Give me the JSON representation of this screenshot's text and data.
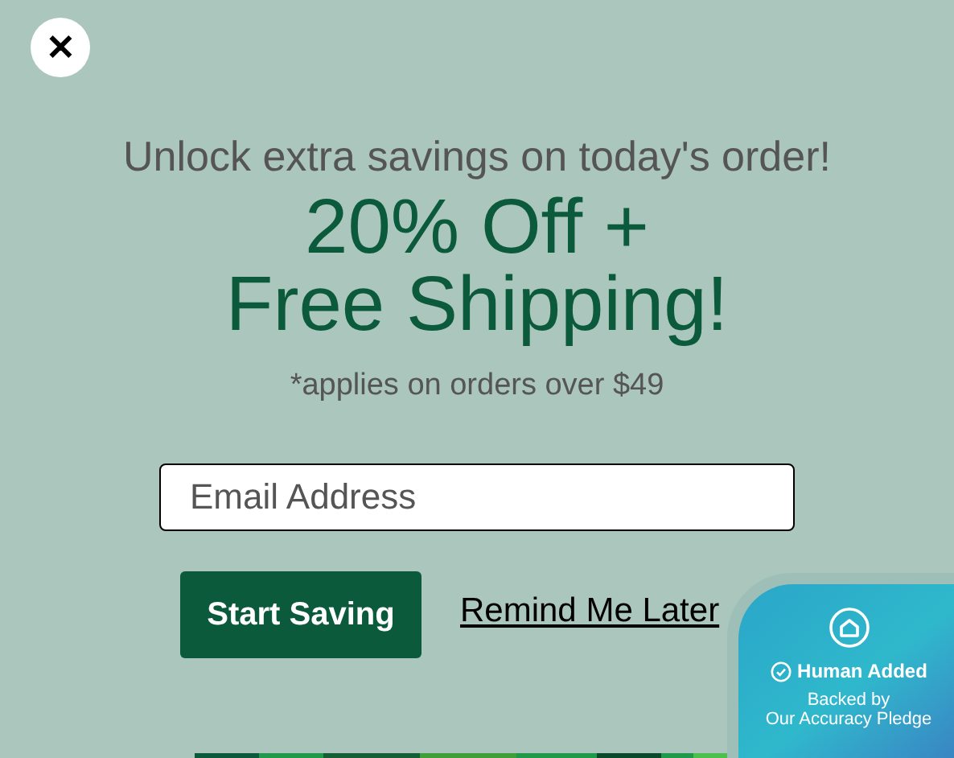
{
  "close_button": {
    "label": "✕"
  },
  "subtitle": "Unlock extra savings on today's order!",
  "offer_lines": [
    "20% Off +",
    "Free Shipping!"
  ],
  "note": "*applies on orders over $49",
  "email": {
    "placeholder": "Email Address"
  },
  "primary_button": "Start Saving",
  "secondary_link": "Remind Me Later",
  "badge": {
    "title": "Human Added",
    "lines": [
      "Backed by",
      "Our Accuracy Pledge"
    ]
  }
}
